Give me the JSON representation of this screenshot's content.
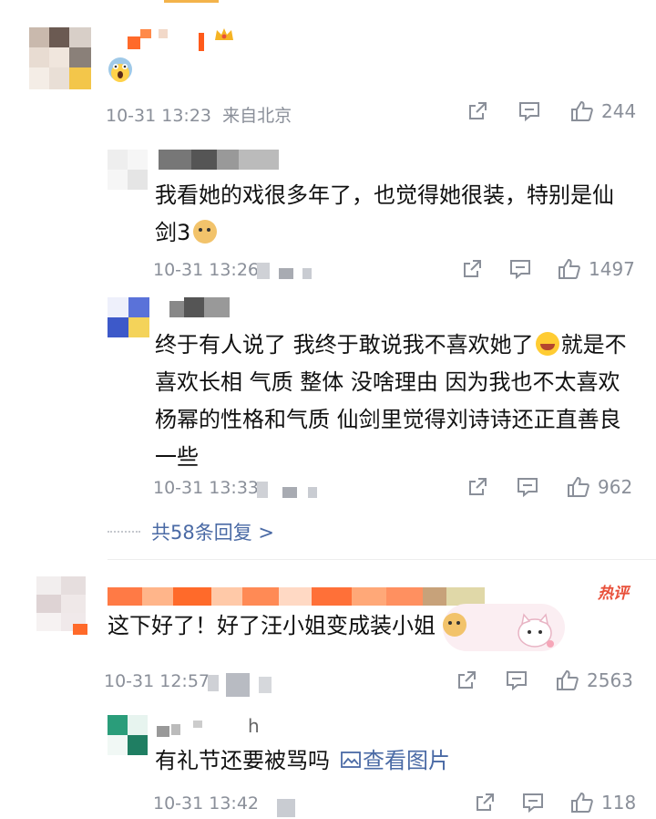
{
  "comments": [
    {
      "time": "10-31 13:23",
      "location": "来自北京",
      "likes": "244",
      "replies": [
        {
          "text": "我看她的戏很多年了，也觉得她很装，特别是仙剑3",
          "time": "10-31 13:26",
          "likes": "1497"
        },
        {
          "text": "终于有人说了 我终于敢说我不喜欢她了",
          "text_after": "就是不喜欢长相 气质 整体 没啥理由 因为我也不太喜欢杨幂的性格和气质 仙剑里觉得刘诗诗还正直善良一些",
          "time": "10-31 13:33",
          "likes": "962"
        }
      ],
      "more_replies": "共58条回复 >"
    },
    {
      "hot_label": "热评",
      "text": "这下好了！好了汪小姐变成装小姐",
      "time": "10-31 12:57",
      "likes": "2563",
      "replies": [
        {
          "name_suffix": "h",
          "text": "有礼节还要被骂吗",
          "link": "查看图片",
          "time": "10-31 13:42",
          "likes": "118"
        }
      ]
    }
  ],
  "icons": [
    "share-icon",
    "comment-icon",
    "like-icon",
    "scream-emoji",
    "doge-emoji",
    "laugh-cry-emoji",
    "image-icon"
  ],
  "colors": {
    "accent_blue": "#4a6aa5",
    "hot_red": "#e8503a",
    "meta_gray": "#8a8f99"
  }
}
